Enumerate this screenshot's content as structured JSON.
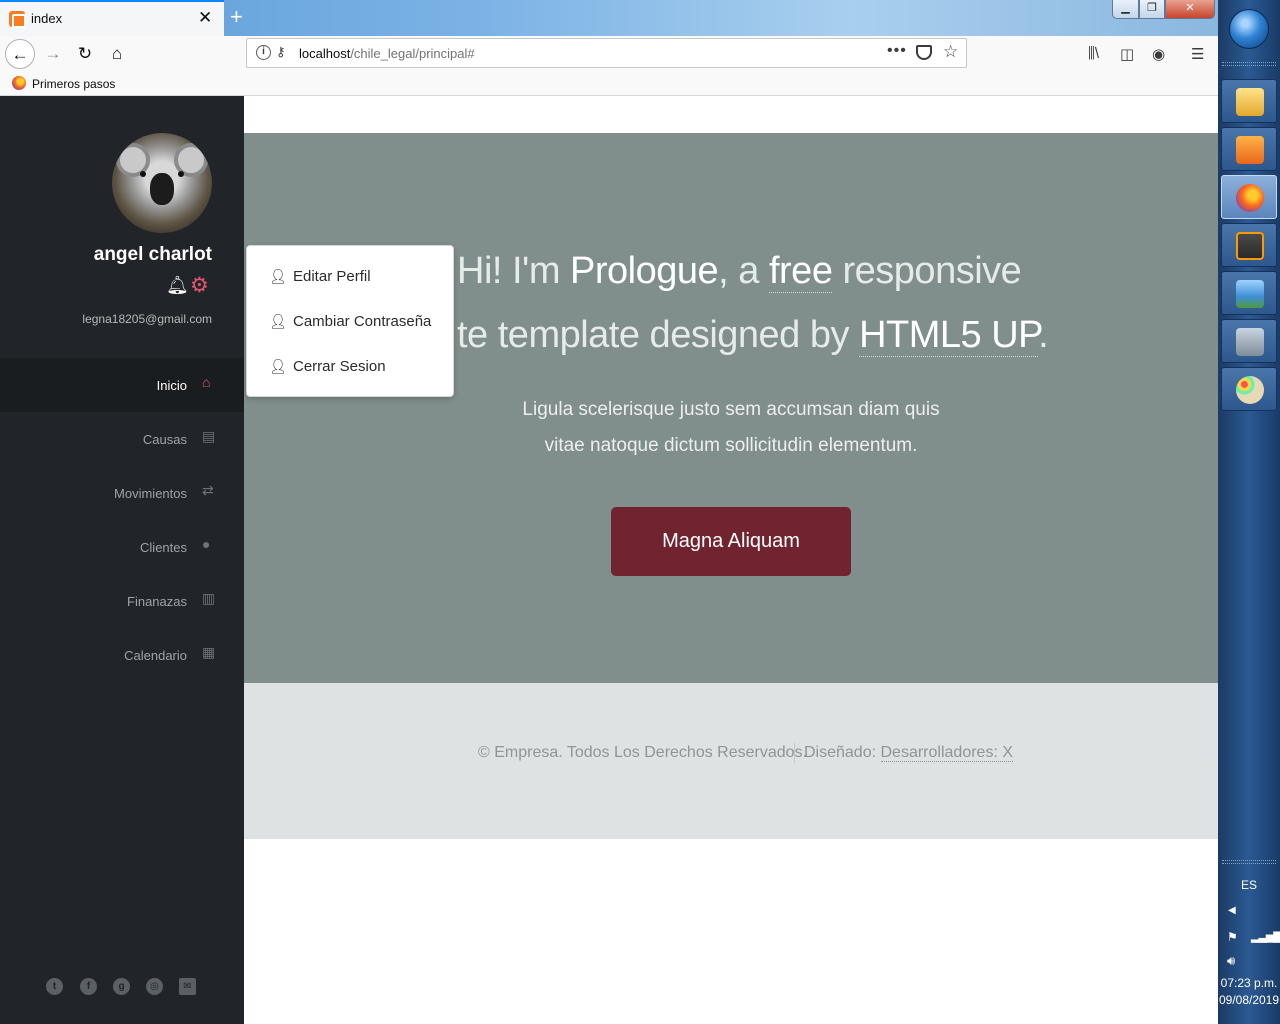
{
  "browser": {
    "tab_title": "index",
    "tab_close": "✕",
    "new_tab": "+",
    "url_host": "localhost",
    "url_path": "/chile_legal/principal#",
    "url_more": "•••",
    "bookmark_label": "Primeros pasos"
  },
  "sidebar": {
    "user_name": "angel charlot",
    "user_email": "legna18205@gmail.com",
    "menu": [
      {
        "label": "Inicio",
        "icon": "home-icon",
        "active": true
      },
      {
        "label": "Causas",
        "icon": "file-icon"
      },
      {
        "label": "Movimientos",
        "icon": "exchange-icon"
      },
      {
        "label": "Clientes",
        "icon": "user-icon"
      },
      {
        "label": "Finanazas",
        "icon": "bar-chart-icon"
      },
      {
        "label": "Calendario",
        "icon": "calendar-icon"
      }
    ],
    "social": [
      "twitter-icon",
      "facebook-icon",
      "github-icon",
      "dribbble-icon",
      "envelope-icon"
    ]
  },
  "dropdown": {
    "items": [
      {
        "label": "Editar Perfil",
        "icon": "user-edit-icon"
      },
      {
        "label": "Cambiar Contraseña",
        "icon": "user-lock-icon"
      },
      {
        "label": "Cerrar Sesion",
        "icon": "user-times-icon"
      }
    ]
  },
  "hero": {
    "l1_a": "Hi! I'm ",
    "l1_b": "Prologue",
    "l1_c": ", a ",
    "l1_d": "free",
    "l1_e": " responsive",
    "l2_a": "te template designed by ",
    "l2_b": "HTML5 UP",
    "l2_c": ".",
    "subtitle_1": "Ligula scelerisque justo sem accumsan diam quis",
    "subtitle_2": "vitae natoque dictum sollicitudin elementum.",
    "button_label": "Magna Aliquam",
    "button_color": "#71232f",
    "background_color": "#808e8c"
  },
  "footer": {
    "copyright": "© Empresa. Todos Los Derechos Reservados.",
    "designed_prefix": "Diseñado: ",
    "designed_link": "Desarrolladores: X"
  },
  "taskbar": {
    "language": "ES",
    "time": "07:23 p.m.",
    "date": "09/08/2019"
  },
  "colors": {
    "sidebar_bg": "#212529",
    "accent": "#e3566b"
  }
}
